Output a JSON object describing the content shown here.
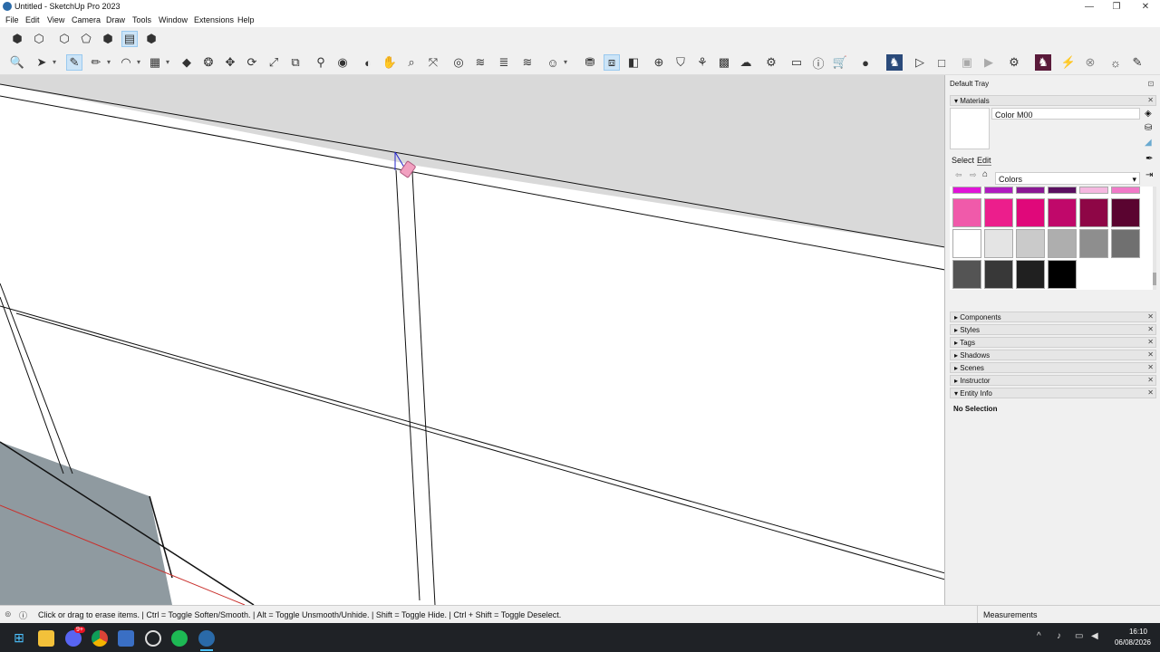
{
  "window": {
    "title": "Untitled - SketchUp Pro 2023",
    "minimize": "—",
    "restore": "❐",
    "close": "✕"
  },
  "menu": [
    "File",
    "Edit",
    "View",
    "Camera",
    "Draw",
    "Tools",
    "Window",
    "Extensions",
    "Help"
  ],
  "toolbar_top": [
    "box-solid-icon",
    "box-outline-icon",
    "box-xray-icon",
    "box-wire-icon",
    "box-shaded-icon",
    "box-textured-icon",
    "box-monochrome-icon"
  ],
  "toolbar_main": [
    "zoom-icon",
    "select-icon",
    "eraser-icon",
    "pencil-icon",
    "arc-icon",
    "shape-icon",
    "pushpull-icon",
    "followme-icon",
    "move-icon",
    "rotate-icon",
    "scale-icon",
    "offset-icon",
    "tape-icon",
    "paint-icon",
    "orbit-icon",
    "pan-icon",
    "zoom-window-icon",
    "zoom-extents-icon",
    "sections-icon",
    "layers-icon",
    "styles-icon",
    "dimension-icon",
    "account-icon",
    "warehouse-icon",
    "share-icon",
    "extension-icon",
    "section-plane-icon",
    "info-icon",
    "cart-icon",
    "profile-icon",
    "play-icon",
    "stop-icon",
    "camera-icon",
    "video-icon",
    "settings-icon",
    "brand-icon",
    "bolt-icon",
    "close-circle-icon",
    "bulb-icon",
    "pen-icon"
  ],
  "tray": {
    "title": "Default Tray",
    "materials_header": "Materials",
    "material_name": "Color M00",
    "tab_select": "Select",
    "tab_edit": "Edit",
    "library": "Colors",
    "swatches_top": [
      "#e014d8",
      "#b01cc0",
      "#8a1894",
      "#5a1060",
      "#f5b8e0",
      "#f07ac8"
    ],
    "swatches_row1": [
      "#f05aaa",
      "#ec1e8c",
      "#e0087a",
      "#c0086a",
      "#8e0646",
      "#5a0430"
    ],
    "swatches_row2": [
      "#ffffff",
      "#e4e4e4",
      "#cacaca",
      "#aeaeae",
      "#8e8e8e",
      "#707070"
    ],
    "swatches_row3": [
      "#545454",
      "#383838",
      "#202020",
      "#000000"
    ],
    "panels": [
      "Components",
      "Styles",
      "Tags",
      "Shadows",
      "Scenes",
      "Instructor"
    ],
    "entity_info": "Entity Info",
    "no_selection": "No Selection"
  },
  "status": {
    "hint": "Click or drag to erase items. | Ctrl = Toggle Soften/Smooth. | Alt = Toggle Unsmooth/Unhide. | Shift = Toggle Hide. | Ctrl + Shift = Toggle Deselect.",
    "measurements_label": "Measurements"
  },
  "taskbar": {
    "time": "16:10",
    "date": "06/08/2026",
    "apps": [
      "start",
      "explorer",
      "discord",
      "chrome",
      "app-blue",
      "app-outline",
      "spotify",
      "sketchup"
    ],
    "badge": "9+"
  }
}
